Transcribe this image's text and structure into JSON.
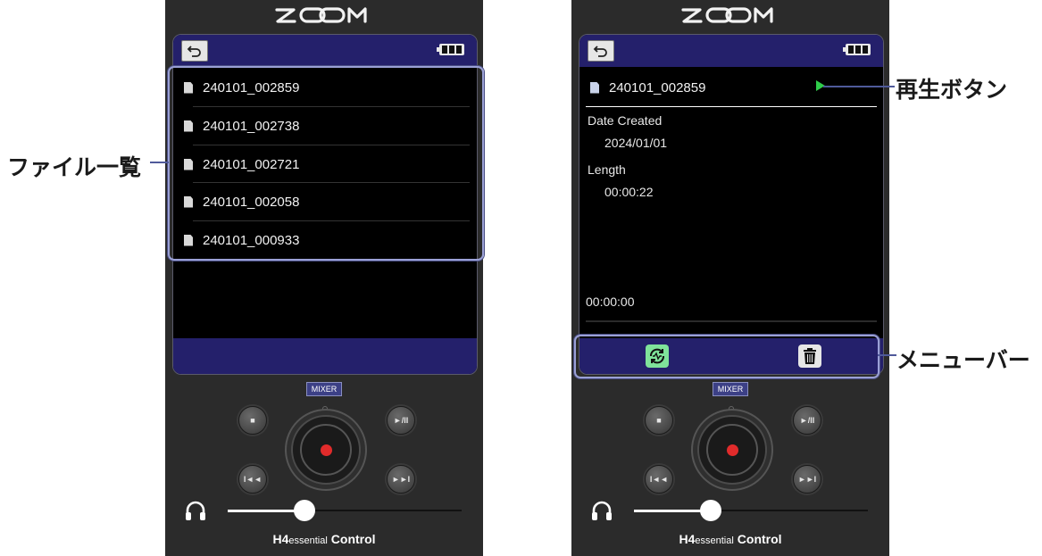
{
  "left_screen": {
    "files": [
      "240101_002859",
      "240101_002738",
      "240101_002721",
      "240101_002058",
      "240101_000933"
    ]
  },
  "right_screen": {
    "file_name": "240101_002859",
    "date_created_label": "Date Created",
    "date_created_value": "2024/01/01",
    "length_label": "Length",
    "length_value": "00:00:22",
    "position": "00:00:00"
  },
  "callouts": {
    "file_list": "ファイル一覧",
    "play_button": "再生ボタン",
    "menu_bar": "メニューバー"
  },
  "controls": {
    "mixer_label": "MIXER",
    "stop_symbol": "■",
    "play_pause_symbol": "►/II",
    "rewind_symbol": "I◄◄",
    "forward_symbol": "►►I",
    "headphone_volume": 0.3
  },
  "brand": {
    "model": "H4",
    "model_suffix": "essential",
    "app_name": "Control"
  },
  "colors": {
    "accent_blue": "#24206b",
    "play_green": "#2fcc4a",
    "record_red": "#e12b2b"
  }
}
